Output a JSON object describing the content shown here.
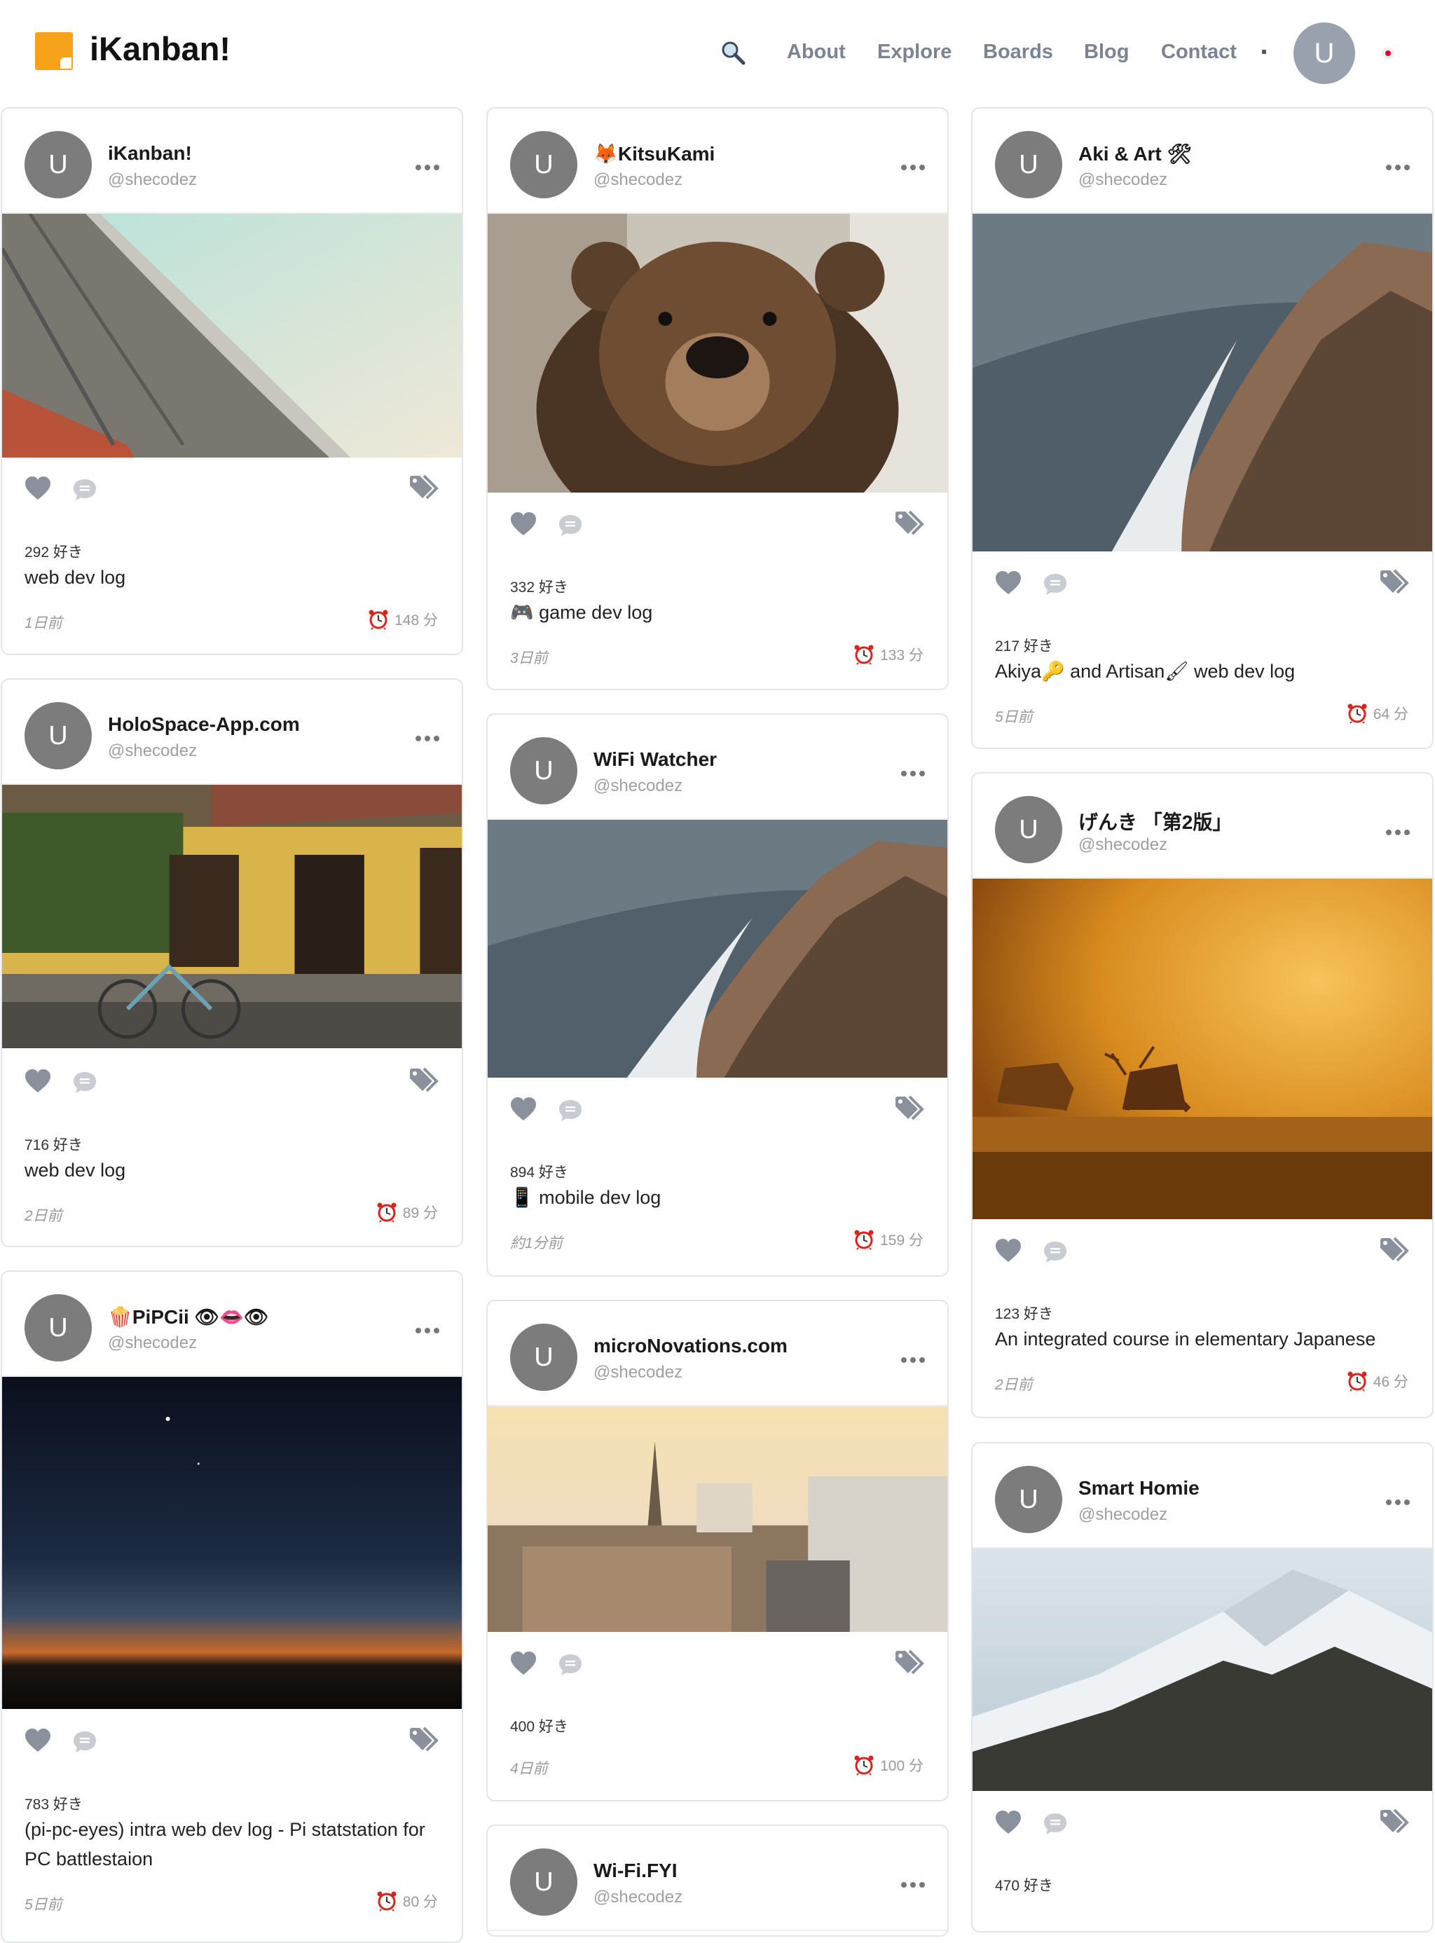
{
  "nav": {
    "logo": "iKanban!",
    "links": [
      "About",
      "Explore",
      "Boards",
      "Blog",
      "Contact"
    ],
    "avatar": "U"
  },
  "posts": [
    {
      "title": "iKanban!",
      "user": "@shecodez",
      "avatar": "U",
      "likes": "292 好き",
      "desc": "web dev log",
      "ago": "1日前",
      "read": "148 分",
      "image": "architecture-icon"
    },
    {
      "title": "🦊KitsuKami",
      "user": "@shecodez",
      "avatar": "U",
      "likes": "332 好き",
      "desc": "🎮 game dev log",
      "ago": "3日前",
      "read": "133 分",
      "image": "bear-icon"
    },
    {
      "title": "Aki & Art 🛠",
      "user": "@shecodez",
      "avatar": "U",
      "likes": "217 好き",
      "desc": "Akiya🔑 and Artisan🖌 web dev log",
      "ago": "5日前",
      "read": "64 分",
      "image": "rock-wave-icon"
    },
    {
      "title": "HoloSpace-App.com",
      "user": "@shecodez",
      "avatar": "U",
      "likes": "716 好き",
      "desc": "web dev log",
      "ago": "2日前",
      "read": "89 分",
      "image": "street-icon"
    },
    {
      "title": "WiFi Watcher",
      "user": "@shecodez",
      "avatar": "U",
      "likes": "894 好き",
      "desc": "📱 mobile dev log",
      "ago": "約1分前",
      "read": "159 分",
      "image": "rock-wave-icon"
    },
    {
      "title": "げんき 「第2版」",
      "user": "@shecodez",
      "avatar": "U",
      "likes": "123 好き",
      "desc": "An integrated course in elementary Japanese",
      "ago": "2日前",
      "read": "46 分",
      "image": "deer-icon"
    },
    {
      "title": "🍿PiPCii 👁👄👁",
      "user": "@shecodez",
      "avatar": "U",
      "likes": "783 好き",
      "desc": "(pi-pc-eyes) intra web dev log - Pi statstation for PC battlestaion",
      "ago": "5日前",
      "read": "80 分",
      "image": "night-sky-icon"
    },
    {
      "title": "microNovations.com",
      "user": "@shecodez",
      "avatar": "U",
      "likes": "400 好き",
      "desc": "",
      "ago": "4日前",
      "read": "100 分",
      "image": "city-icon"
    },
    {
      "title": "Smart Homie",
      "user": "@shecodez",
      "avatar": "U",
      "likes": "470 好き",
      "desc": "",
      "ago": "",
      "read": "",
      "image": "mountain-icon"
    },
    {
      "title": "Wi-Fi.FYI",
      "user": "@shecodez",
      "avatar": "U",
      "likes": "",
      "desc": "",
      "ago": "",
      "read": "",
      "image": ""
    }
  ]
}
